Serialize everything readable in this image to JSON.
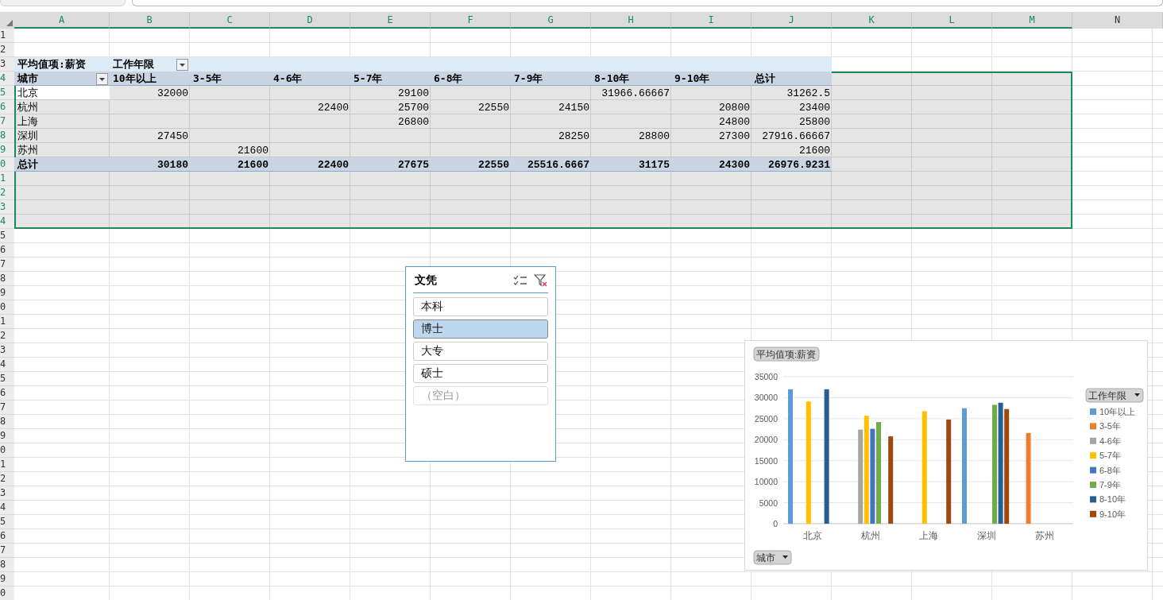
{
  "sheet_tabs": [
    {
      "selected": false
    },
    {
      "selected": true
    }
  ],
  "column_headers": [
    {
      "label": "A",
      "selected": true
    },
    {
      "label": "B",
      "selected": true
    },
    {
      "label": "C",
      "selected": true
    },
    {
      "label": "D",
      "selected": true
    },
    {
      "label": "E",
      "selected": true
    },
    {
      "label": "F",
      "selected": true
    },
    {
      "label": "G",
      "selected": true
    },
    {
      "label": "H",
      "selected": true
    },
    {
      "label": "I",
      "selected": true
    },
    {
      "label": "J",
      "selected": true
    },
    {
      "label": "K",
      "selected": true
    },
    {
      "label": "L",
      "selected": true
    },
    {
      "label": "M",
      "selected": true
    },
    {
      "label": "N",
      "selected": false
    }
  ],
  "row_headers": [
    {
      "label": "1",
      "selected": false
    },
    {
      "label": "2",
      "selected": false
    },
    {
      "label": "3",
      "selected": false
    },
    {
      "label": "4",
      "selected": true
    },
    {
      "label": "5",
      "selected": true
    },
    {
      "label": "6",
      "selected": true
    },
    {
      "label": "7",
      "selected": true
    },
    {
      "label": "8",
      "selected": true
    },
    {
      "label": "9",
      "selected": true
    },
    {
      "label": "0",
      "selected": true
    },
    {
      "label": "1",
      "selected": true
    },
    {
      "label": "2",
      "selected": true
    },
    {
      "label": "3",
      "selected": true
    },
    {
      "label": "4",
      "selected": true
    },
    {
      "label": "5",
      "selected": false
    },
    {
      "label": "6",
      "selected": false
    },
    {
      "label": "7",
      "selected": false
    },
    {
      "label": "8",
      "selected": false
    },
    {
      "label": "9",
      "selected": false
    },
    {
      "label": "0",
      "selected": false
    },
    {
      "label": "1",
      "selected": false
    },
    {
      "label": "2",
      "selected": false
    },
    {
      "label": "3",
      "selected": false
    },
    {
      "label": "4",
      "selected": false
    },
    {
      "label": "5",
      "selected": false
    },
    {
      "label": "6",
      "selected": false
    },
    {
      "label": "7",
      "selected": false
    },
    {
      "label": "8",
      "selected": false
    },
    {
      "label": "9",
      "selected": false
    },
    {
      "label": "0",
      "selected": false
    },
    {
      "label": "1",
      "selected": false
    },
    {
      "label": "2",
      "selected": false
    },
    {
      "label": "3",
      "selected": false
    },
    {
      "label": "4",
      "selected": false
    },
    {
      "label": "5",
      "selected": false
    },
    {
      "label": "6",
      "selected": false
    },
    {
      "label": "7",
      "selected": false
    },
    {
      "label": "8",
      "selected": false
    },
    {
      "label": "9",
      "selected": false
    },
    {
      "label": "0",
      "selected": false
    }
  ],
  "pivot": {
    "title": "平均值项:薪资",
    "column_field": "工作年限",
    "row_field": "城市",
    "columns": [
      "10年以上",
      "3-5年",
      "4-6年",
      "5-7年",
      "6-8年",
      "7-9年",
      "8-10年",
      "9-10年",
      "总计"
    ],
    "rows": [
      {
        "city": "北京",
        "active": true,
        "values": {
          "col_1": "32000",
          "col_4": "29100",
          "col_7": "31966.66667",
          "col_9": "31262.5"
        }
      },
      {
        "city": "杭州",
        "active": false,
        "values": {
          "col_3": "22400",
          "col_4": "25700",
          "col_5": "22550",
          "col_6": "24150",
          "col_8": "20800",
          "col_9": "23400"
        }
      },
      {
        "city": "上海",
        "active": false,
        "values": {
          "col_4": "26800",
          "col_8": "24800",
          "col_9": "25800"
        }
      },
      {
        "city": "深圳",
        "active": false,
        "values": {
          "col_1": "27450",
          "col_6": "28250",
          "col_7": "28800",
          "col_8": "27300",
          "col_9": "27916.66667"
        }
      },
      {
        "city": "苏州",
        "active": false,
        "values": {
          "col_2": "21600",
          "col_9": "21600"
        }
      }
    ],
    "total": {
      "label": "总计",
      "values": [
        "30180",
        "21600",
        "22400",
        "27675",
        "22550",
        "25516.6667",
        "31175",
        "24300",
        "26976.9231"
      ]
    }
  },
  "slicer": {
    "title": "文凭",
    "items": [
      {
        "label": "本科",
        "selected": false,
        "disabled": false
      },
      {
        "label": "博士",
        "selected": true,
        "disabled": false
      },
      {
        "label": "大专",
        "selected": false,
        "disabled": false
      },
      {
        "label": "硕士",
        "selected": false,
        "disabled": false
      },
      {
        "label": "（空白）",
        "selected": false,
        "disabled": true
      }
    ]
  },
  "chart": {
    "value_button": "平均值项:薪资",
    "legend_button": "工作年限",
    "axis_button": "城市",
    "chart_data": {
      "type": "bar",
      "grid": true,
      "legend": true,
      "categories": [
        "北京",
        "杭州",
        "上海",
        "深圳",
        "苏州"
      ],
      "ylim": [
        0,
        35000
      ],
      "yticks": [
        0,
        5000,
        10000,
        15000,
        20000,
        25000,
        30000,
        35000
      ],
      "series": [
        {
          "name": "10年以上",
          "color": "#5b9bd5",
          "values": [
            32000,
            null,
            null,
            27500,
            null
          ]
        },
        {
          "name": "3-5年",
          "color": "#ed7d31",
          "values": [
            null,
            null,
            null,
            null,
            21600
          ]
        },
        {
          "name": "4-6年",
          "color": "#a5a5a5",
          "values": [
            null,
            22400,
            null,
            null,
            null
          ]
        },
        {
          "name": "5-7年",
          "color": "#ffc000",
          "values": [
            29100,
            25700,
            26800,
            null,
            null
          ]
        },
        {
          "name": "6-8年",
          "color": "#4472c4",
          "values": [
            null,
            22600,
            null,
            null,
            null
          ]
        },
        {
          "name": "7-9年",
          "color": "#70ad47",
          "values": [
            null,
            24200,
            null,
            28300,
            null
          ]
        },
        {
          "name": "8-10年",
          "color": "#255e91",
          "values": [
            32000,
            null,
            null,
            28800,
            null
          ]
        },
        {
          "name": "9-10年",
          "color": "#9e480e",
          "values": [
            null,
            20800,
            24800,
            27300,
            null
          ]
        }
      ]
    }
  }
}
